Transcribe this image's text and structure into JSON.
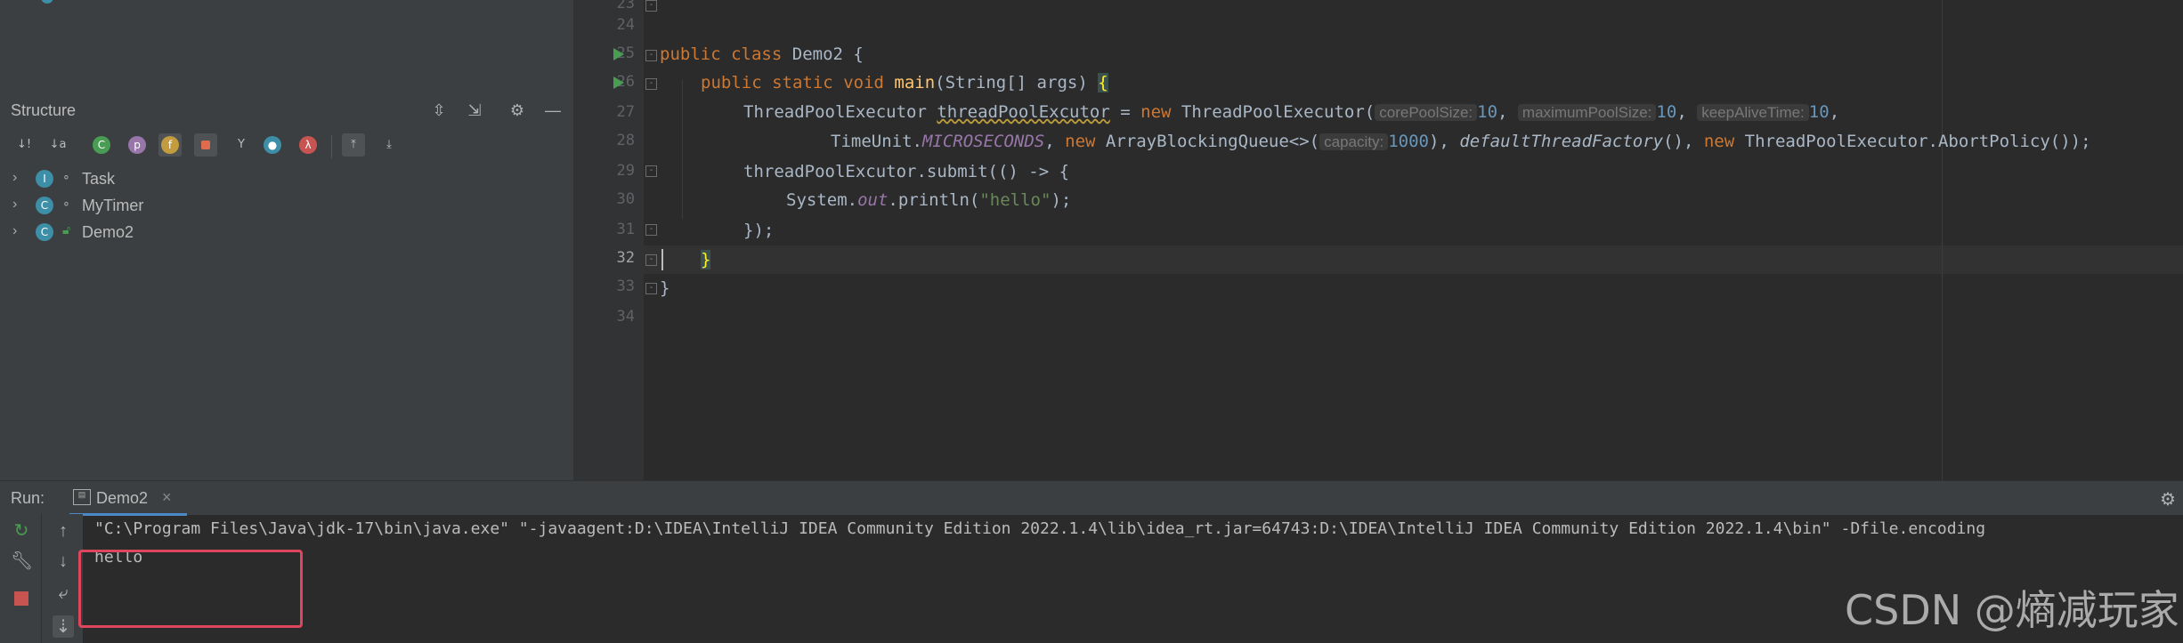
{
  "structure": {
    "title": "Structure",
    "toolbar": {
      "sort_visibility": "↓!",
      "sort_alpha": "↓a",
      "inherited": "C",
      "properties": "p",
      "fields": "f",
      "non_public": "🔒",
      "lambdas": "λ"
    },
    "items": [
      {
        "label": "Task",
        "icon_letter": "I"
      },
      {
        "label": "MyTimer",
        "icon_letter": "C"
      },
      {
        "label": "Demo2",
        "icon_letter": "C"
      }
    ]
  },
  "editor": {
    "line_numbers": [
      "23",
      "24",
      "25",
      "26",
      "27",
      "28",
      "29",
      "30",
      "31",
      "32",
      "33",
      "34"
    ],
    "lines": {
      "l25": {
        "kw1": "public",
        "kw2": "class",
        "name": "Demo2 {"
      },
      "l26": {
        "kw1": "public",
        "kw2": "static",
        "kw3": "void",
        "fn": "main",
        "rest": "(String[] args) ",
        "brace": "{"
      },
      "l27": {
        "type": "ThreadPoolExecutor ",
        "var": "threadPoolExcutor",
        "eq": " = ",
        "kw": "new",
        "cls": " ThreadPoolExecutor(",
        "h1": "corePoolSize:",
        "v1": "10",
        "c1": ", ",
        "h2": "maximumPoolSize:",
        "v2": "10",
        "c2": ", ",
        "h3": "keepAliveTime:",
        "v3": "10",
        "c3": ","
      },
      "l28": {
        "tu": "TimeUnit.",
        "micro": "MICROSECONDS",
        "c1": ", ",
        "kw": "new",
        "abq": " ArrayBlockingQueue<>(",
        "h1": "capacity:",
        "v1": "1000",
        "c2": "), ",
        "dtf": "defaultThreadFactory",
        "c3": "(), ",
        "kw2": "new",
        "rest": " ThreadPoolExecutor.AbortPolicy());"
      },
      "l29": {
        "text": "threadPoolExcutor.submit(() -> {"
      },
      "l30": {
        "sys": "System.",
        "out": "out",
        "pr": ".println(",
        "str": "\"hello\"",
        "end": ");"
      },
      "l31": {
        "text": "});"
      },
      "l32": {
        "brace": "}"
      },
      "l33": {
        "brace": "}"
      }
    }
  },
  "run": {
    "title": "Run:",
    "tab_label": "Demo2",
    "tab_close": "×",
    "console": [
      "\"C:\\Program Files\\Java\\jdk-17\\bin\\java.exe\" \"-javaagent:D:\\IDEA\\IntelliJ IDEA Community Edition 2022.1.4\\lib\\idea_rt.jar=64743:D:\\IDEA\\IntelliJ IDEA Community Edition 2022.1.4\\bin\" -Dfile.encoding",
      "hello"
    ]
  },
  "watermark": "CSDN @熵减玩家",
  "colors": {
    "accent": "#4a88c7",
    "highlight_box": "#e0455e",
    "keyword": "#cc7832",
    "string": "#6a8759",
    "number": "#6897bb"
  }
}
